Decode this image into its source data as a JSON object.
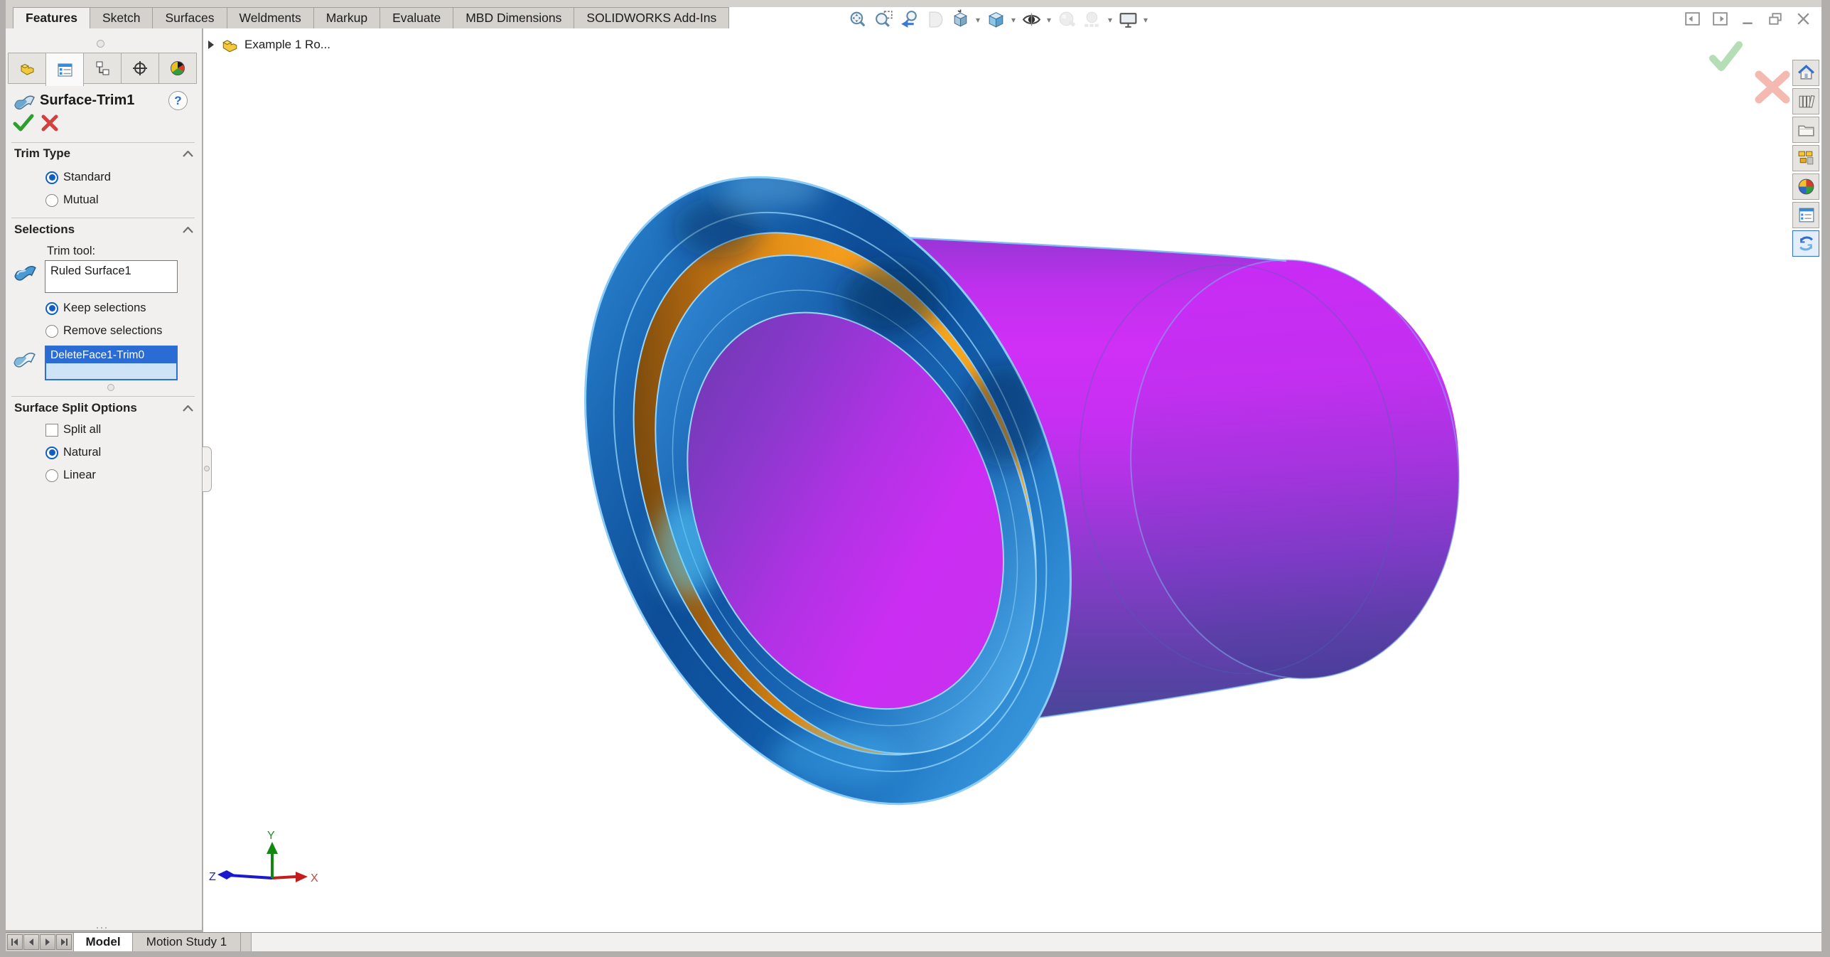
{
  "command_tabs": {
    "items": [
      {
        "label": "Features",
        "active": true
      },
      {
        "label": "Sketch",
        "active": false
      },
      {
        "label": "Surfaces",
        "active": false
      },
      {
        "label": "Weldments",
        "active": false
      },
      {
        "label": "Markup",
        "active": false
      },
      {
        "label": "Evaluate",
        "active": false
      },
      {
        "label": "MBD Dimensions",
        "active": false
      },
      {
        "label": "SOLIDWORKS Add-Ins",
        "active": false
      }
    ]
  },
  "feature_tree": {
    "root_item": "Example 1 Ro..."
  },
  "property_manager": {
    "title": "Surface-Trim1",
    "help_label": "?",
    "tabs": [
      "feature-manager",
      "property-manager",
      "configuration-manager",
      "dimxpert-manager",
      "display-manager"
    ],
    "active_tab": "property-manager",
    "trim_type": {
      "header": "Trim Type",
      "options": [
        {
          "label": "Standard",
          "selected": true
        },
        {
          "label": "Mutual",
          "selected": false
        }
      ]
    },
    "selections": {
      "header": "Selections",
      "trim_tool_label": "Trim tool:",
      "trim_tool_value": "Ruled Surface1",
      "keep_option": {
        "label": "Keep selections",
        "selected": true
      },
      "remove_option": {
        "label": "Remove selections",
        "selected": false
      },
      "items": [
        "DeleteFace1-Trim0"
      ]
    },
    "surface_split": {
      "header": "Surface Split Options",
      "checkbox": {
        "label": "Split all",
        "checked": false
      },
      "options": [
        {
          "label": "Natural",
          "selected": true
        },
        {
          "label": "Linear",
          "selected": false
        }
      ]
    }
  },
  "heads_up_toolbar": {
    "items": [
      {
        "name": "zoom-to-fit",
        "disabled": false,
        "dropdown": false
      },
      {
        "name": "zoom-to-area",
        "disabled": false,
        "dropdown": false
      },
      {
        "name": "previous-view",
        "disabled": false,
        "dropdown": false
      },
      {
        "name": "section-view",
        "disabled": true,
        "dropdown": false
      },
      {
        "name": "view-orientation",
        "disabled": false,
        "dropdown": true
      },
      {
        "name": "display-style",
        "disabled": false,
        "dropdown": true
      },
      {
        "name": "hide-show-items",
        "disabled": false,
        "dropdown": true
      },
      {
        "name": "edit-appearance",
        "disabled": true,
        "dropdown": false
      },
      {
        "name": "apply-scene",
        "disabled": true,
        "dropdown": true
      },
      {
        "name": "view-settings",
        "disabled": false,
        "dropdown": true
      }
    ]
  },
  "window_controls": [
    "collapse-left-pane",
    "collapse-right-pane",
    "minimize",
    "restore",
    "close"
  ],
  "task_pane": {
    "items": [
      "solidworks-resources-home",
      "design-library",
      "file-explorer",
      "view-palette",
      "appearances-scenes",
      "custom-properties",
      "solidworks-sync"
    ],
    "selected_index": 6
  },
  "viewport": {
    "triad": {
      "x": "X",
      "y": "Y",
      "z": "Z"
    },
    "confirmation": [
      "accept",
      "cancel"
    ]
  },
  "bottom_bar": {
    "nav": [
      "first",
      "previous",
      "next",
      "last"
    ],
    "tabs": [
      {
        "label": "Model",
        "active": true
      },
      {
        "label": "Motion Study 1",
        "active": false
      }
    ]
  },
  "colors": {
    "accent_blue": "#2a6bd4",
    "selection_row_blue": "#2a6bd4",
    "selection_list_fill": "#cfe3f6",
    "ok_green": "#2f9e2f",
    "cancel_red": "#d34040",
    "flange_blue": "#0f55a2",
    "trim_orange": "#f49d1e",
    "cylinder_magenta": "#cb2ef2",
    "cylinder_purple_dark": "#4a4699",
    "edge_highlight": "#8ccdf8",
    "panel_bg": "#f1f0ee",
    "strip_bg": "#d5d2ce"
  }
}
